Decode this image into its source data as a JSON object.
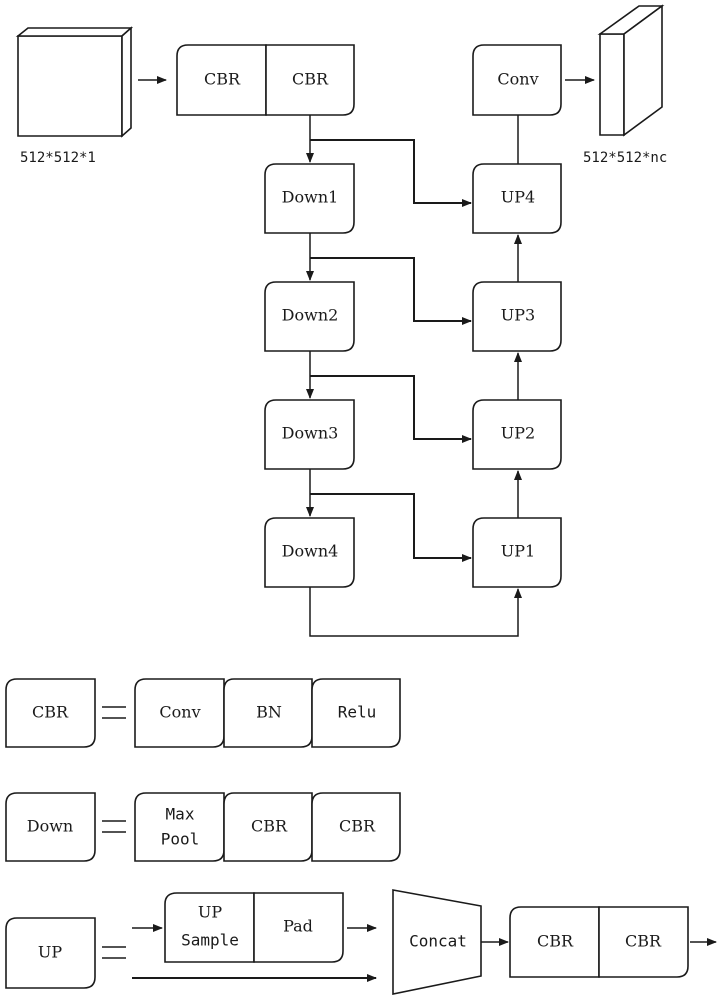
{
  "input": {
    "label": "512*512*1"
  },
  "output": {
    "label": "512*512*nc"
  },
  "encoder": {
    "cbr1": "CBR",
    "cbr2": "CBR",
    "down": [
      "Down1",
      "Down2",
      "Down3",
      "Down4"
    ]
  },
  "decoder": {
    "conv": "Conv",
    "up": [
      "UP4",
      "UP3",
      "UP2",
      "UP1"
    ]
  },
  "legend": {
    "cbr": {
      "name": "CBR",
      "equals": "=",
      "parts": [
        "Conv",
        "BN",
        "Relu"
      ]
    },
    "down": {
      "name": "Down",
      "equals": "=",
      "parts": [
        "Max",
        "Pool",
        "CBR",
        "CBR"
      ]
    },
    "up": {
      "name": "UP",
      "equals": "=",
      "upsample_line1": "UP",
      "upsample_line2": "Sample",
      "pad": "Pad",
      "concat": "Concat",
      "cbr1": "CBR",
      "cbr2": "CBR"
    }
  }
}
